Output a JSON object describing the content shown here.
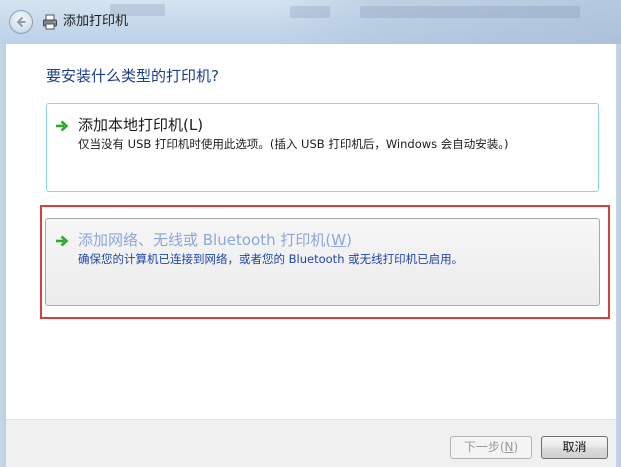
{
  "window": {
    "title": "添加打印机"
  },
  "main": {
    "question": "要安装什么类型的打印机?",
    "options": [
      {
        "title_prefix": "添加本地打印机(",
        "accel": "L",
        "title_suffix": ")",
        "description": "仅当没有 USB 打印机时使用此选项。(插入 USB 打印机后，Windows 会自动安装。)",
        "state": "normal"
      },
      {
        "title_prefix": "添加网络、无线或 Bluetooth 打印机(",
        "accel": "W",
        "title_suffix": ")",
        "description": "确保您的计算机已连接到网络，或者您的 Bluetooth 或无线打印机已启用。",
        "state": "hover",
        "highlighted": true
      }
    ]
  },
  "footer": {
    "next_prefix": "下一步(",
    "next_accel": "N",
    "next_suffix": ")",
    "next_enabled": false,
    "cancel_label": "取消"
  },
  "colors": {
    "highlight_border": "#d9403a",
    "question_text": "#1c3e8c",
    "arrow_green": "#2fa82f"
  },
  "icons": {
    "back": "back-arrow-icon",
    "printer": "printer-icon",
    "option_arrow": "green-arrow-icon"
  }
}
